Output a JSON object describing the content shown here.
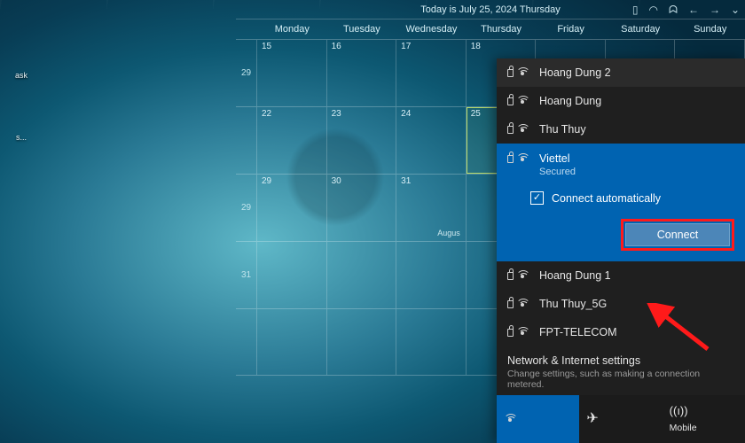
{
  "desktop": {
    "icon1": "ask",
    "icon2": "s..."
  },
  "calendar": {
    "title": "Today is July 25, 2024 Thursday",
    "weekdays": [
      "Monday",
      "Tuesday",
      "Wednesday",
      "Thursday",
      "Friday",
      "Saturday",
      "Sunday"
    ],
    "weeks": [
      {
        "wk": "29",
        "days": [
          "15",
          "16",
          "17",
          "18",
          "",
          "",
          ""
        ],
        "today": null
      },
      {
        "wk": "",
        "days": [
          "22",
          "23",
          "24",
          "25",
          "",
          "",
          ""
        ],
        "today": 3
      },
      {
        "wk": "29",
        "days": [
          "29",
          "30",
          "31",
          "",
          "",
          "",
          ""
        ],
        "today": null,
        "events": {
          "2": "Augus"
        }
      },
      {
        "wk": "31",
        "days": [
          "",
          "",
          "",
          "",
          "",
          "",
          ""
        ],
        "today": null
      },
      {
        "wk": "",
        "days": [
          "",
          "",
          "",
          "",
          "",
          "",
          ""
        ],
        "today": null
      }
    ]
  },
  "flyout": {
    "networks_top": [
      {
        "name": "Hoang Dung 2",
        "secured": true
      },
      {
        "name": "Hoang Dung",
        "secured": true
      },
      {
        "name": "Thu Thuy",
        "secured": true
      }
    ],
    "selected": {
      "name": "Viettel",
      "status": "Secured",
      "auto_label": "Connect automatically",
      "auto_checked": true,
      "connect_label": "Connect"
    },
    "networks_bottom": [
      {
        "name": "Hoang Dung 1",
        "secured": true
      },
      {
        "name": "Thu Thuy_5G",
        "secured": true
      },
      {
        "name": "FPT-TELECOM",
        "secured": true
      }
    ],
    "settings_title": "Network & Internet settings",
    "settings_desc": "Change settings, such as making a connection metered.",
    "modes": {
      "wifi": "",
      "airplane": "",
      "hotspot": "Mobile"
    }
  }
}
